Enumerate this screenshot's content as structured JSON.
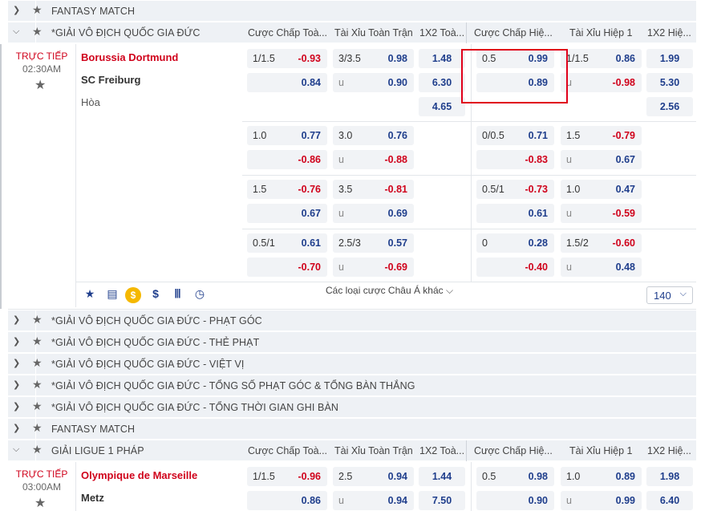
{
  "rows": {
    "fantasy_top": "FANTASY MATCH",
    "league1": "*GIẢI VÔ ĐỊCH QUỐC GIA ĐỨC",
    "sub1": "*GIẢI VÔ ĐỊCH QUỐC GIA ĐỨC - PHẠT GÓC",
    "sub2": "*GIẢI VÔ ĐỊCH QUỐC GIA ĐỨC - THẺ PHẠT",
    "sub3": "*GIẢI VÔ ĐỊCH QUỐC GIA ĐỨC - VIỆT VỊ",
    "sub4": "*GIẢI VÔ ĐỊCH QUỐC GIA ĐỨC - TỔNG SỐ PHẠT GÓC & TỔNG BÀN THẮNG",
    "sub5": "*GIẢI VÔ ĐỊCH QUỐC GIA ĐỨC - TỔNG THỜI GIAN GHI BÀN",
    "fantasy_mid": "FANTASY MATCH",
    "league2": "GIẢI LIGUE 1 PHÁP"
  },
  "headers": [
    "Cược Chấp Toà...",
    "Tài Xỉu Toàn Trận",
    "1X2 Toà...",
    "Cược Chấp Hiệ...",
    "Tài Xỉu Hiệp 1",
    "1X2 Hiệ..."
  ],
  "match1": {
    "live": "TRỰC TIẾP",
    "time": "02:30AM",
    "home": "Borussia Dortmund",
    "away": "SC Freiburg",
    "draw": "Hòa",
    "more_label": "Các loại cược Châu Á khác",
    "count": "140",
    "r0": {
      "ah_h": "1/1.5",
      "ah1": "-0.93",
      "ah2": "0.84",
      "ou_h": "3/3.5",
      "ou_u": "u",
      "ou1": "0.98",
      "ou2": "0.90",
      "x1": "1.48",
      "x2": "6.30",
      "x3": "4.65",
      "hah_h": "0.5",
      "hah1": "0.99",
      "hah2": "0.89",
      "hou_h": "1/1.5",
      "hou_u": "u",
      "hou1": "0.86",
      "hou2": "-0.98",
      "hx1": "1.99",
      "hx2": "5.30",
      "hx3": "2.56"
    },
    "r1": {
      "ah_h": "1.0",
      "ah1": "0.77",
      "ah2": "-0.86",
      "ou_h": "3.0",
      "ou_u": "u",
      "ou1": "0.76",
      "ou2": "-0.88",
      "hah_h": "0/0.5",
      "hah1": "0.71",
      "hah2": "-0.83",
      "hou_h": "1.5",
      "hou_u": "u",
      "hou1": "-0.79",
      "hou2": "0.67"
    },
    "r2": {
      "ah_h": "1.5",
      "ah1": "-0.76",
      "ah2": "0.67",
      "ou_h": "3.5",
      "ou_u": "u",
      "ou1": "-0.81",
      "ou2": "0.69",
      "hah_h": "0.5/1",
      "hah1": "-0.73",
      "hah2": "0.61",
      "hou_h": "1.0",
      "hou_u": "u",
      "hou1": "0.47",
      "hou2": "-0.59"
    },
    "r3": {
      "ah_h": "0.5/1",
      "ah1": "0.61",
      "ah2": "-0.70",
      "ou_h": "2.5/3",
      "ou_u": "u",
      "ou1": "0.57",
      "ou2": "-0.69",
      "hah_h": "0",
      "hah1": "0.28",
      "hah2": "-0.40",
      "hou_h": "1.5/2",
      "hou_u": "u",
      "hou1": "-0.60",
      "hou2": "0.48"
    }
  },
  "match2": {
    "live": "TRỰC TIẾP",
    "time": "03:00AM",
    "home": "Olympique de Marseille",
    "away": "Metz",
    "r0": {
      "ah_h": "1/1.5",
      "ah1": "-0.96",
      "ah2": "0.86",
      "ou_h": "2.5",
      "ou_u": "u",
      "ou1": "0.94",
      "ou2": "0.94",
      "x1": "1.44",
      "x2": "7.50",
      "hah_h": "0.5",
      "hah1": "0.98",
      "hah2": "0.90",
      "hou_h": "1.0",
      "hou_u": "u",
      "hou1": "0.89",
      "hou2": "0.99",
      "hx1": "1.98",
      "hx2": "6.40"
    }
  },
  "colors": {
    "positive": "#1f3e8c",
    "negative": "#d0021b",
    "highlight": "#e0001a"
  }
}
